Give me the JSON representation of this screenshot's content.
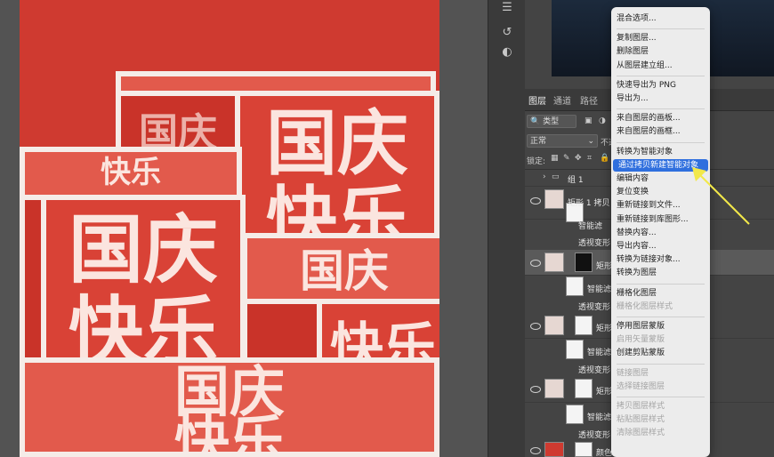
{
  "canvas": {
    "artwork_text": [
      "国庆",
      "快乐"
    ],
    "bg_color": "#cf3a30",
    "cube_face_color": "#d94236",
    "cube_border_color": "#f5ece8"
  },
  "panel": {
    "tabs": [
      "图层",
      "通道",
      "路径"
    ],
    "kind_filter": "类型",
    "blend_mode": "正常",
    "opacity_label": "不透",
    "lock_label": "锁定:",
    "group_name": "组 1"
  },
  "layers": [
    {
      "name": "矩形 1 拷贝 3",
      "type": "smart"
    },
    {
      "name": "智能滤",
      "type": "filter"
    },
    {
      "name": "透视变形",
      "type": "effect"
    },
    {
      "name": "矩形",
      "type": "smart"
    },
    {
      "name": "智能滤",
      "type": "filter"
    },
    {
      "name": "透视变形",
      "type": "effect"
    },
    {
      "name": "矩形",
      "type": "smart"
    },
    {
      "name": "智能滤",
      "type": "filter"
    },
    {
      "name": "透视变形",
      "type": "effect"
    },
    {
      "name": "矩形",
      "type": "smart"
    },
    {
      "name": "智能滤",
      "type": "filter"
    },
    {
      "name": "透视变形",
      "type": "effect"
    },
    {
      "name": "颜色",
      "type": "fill"
    }
  ],
  "context_menu": {
    "items": [
      {
        "label": "混合选项...",
        "enabled": true
      },
      {
        "sep": true
      },
      {
        "label": "复制图层...",
        "enabled": true
      },
      {
        "label": "删除图层",
        "enabled": true
      },
      {
        "label": "从图层建立组...",
        "enabled": true
      },
      {
        "sep": true
      },
      {
        "label": "快速导出为 PNG",
        "enabled": true
      },
      {
        "label": "导出为...",
        "enabled": true
      },
      {
        "sep": true
      },
      {
        "label": "来自图层的画板...",
        "enabled": true
      },
      {
        "label": "来自图层的画框...",
        "enabled": true
      },
      {
        "sep": true
      },
      {
        "label": "转换为智能对象",
        "enabled": true
      },
      {
        "label": "通过拷贝新建智能对象",
        "enabled": true,
        "highlighted": true
      },
      {
        "label": "编辑内容",
        "enabled": true
      },
      {
        "label": "复位变换",
        "enabled": true
      },
      {
        "label": "重新链接到文件...",
        "enabled": true
      },
      {
        "label": "重新链接到库图形...",
        "enabled": true
      },
      {
        "label": "替换内容...",
        "enabled": true
      },
      {
        "label": "导出内容...",
        "enabled": true
      },
      {
        "label": "转换为链接对象...",
        "enabled": true
      },
      {
        "label": "转换为图层",
        "enabled": true
      },
      {
        "sep": true
      },
      {
        "label": "栅格化图层",
        "enabled": true
      },
      {
        "label": "栅格化图层样式",
        "enabled": false
      },
      {
        "sep": true
      },
      {
        "label": "停用图层蒙版",
        "enabled": true
      },
      {
        "label": "启用矢量蒙版",
        "enabled": false
      },
      {
        "label": "创建剪贴蒙版",
        "enabled": true
      },
      {
        "sep": true
      },
      {
        "label": "链接图层",
        "enabled": false
      },
      {
        "label": "选择链接图层",
        "enabled": false
      },
      {
        "sep": true
      },
      {
        "label": "拷贝图层样式",
        "enabled": false
      },
      {
        "label": "粘贴图层样式",
        "enabled": false
      },
      {
        "label": "清除图层样式",
        "enabled": false
      }
    ]
  },
  "colors": {
    "highlight": "#2f6fde",
    "arrow": "#f2e84a",
    "panel_bg": "#444444"
  }
}
